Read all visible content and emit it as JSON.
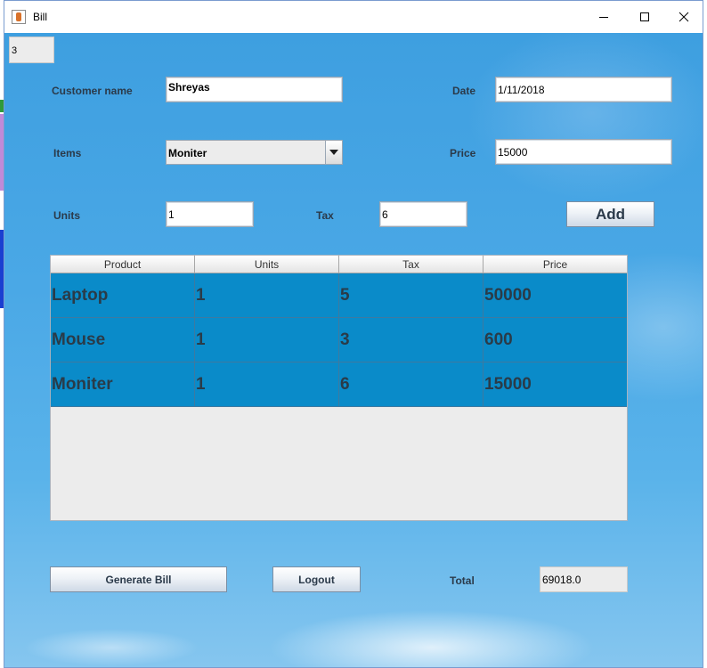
{
  "window": {
    "title": "Bill"
  },
  "form": {
    "counter": "3",
    "customer_label": "Customer name",
    "customer_value": "Shreyas",
    "date_label": "Date",
    "date_value": "1/11/2018",
    "items_label": "Items",
    "items_selected": "Moniter",
    "price_label": "Price",
    "price_value": "15000",
    "units_label": "Units",
    "units_value": "1",
    "tax_label": "Tax",
    "tax_value": "6",
    "add_label": "Add"
  },
  "table": {
    "columns": [
      "Product",
      "Units",
      "Tax",
      "Price"
    ],
    "rows": [
      [
        "Laptop",
        "1",
        "5",
        "50000"
      ],
      [
        "Mouse",
        "1",
        "3",
        "600"
      ],
      [
        "Moniter",
        "1",
        "6",
        "15000"
      ]
    ],
    "row_color": "#0a8bc9"
  },
  "footer": {
    "generate_label": "Generate Bill",
    "logout_label": "Logout",
    "total_label": "Total",
    "total_value": "69018.0"
  },
  "icons": {
    "app": "java-icon",
    "minimize": "minimize-icon",
    "maximize": "maximize-icon",
    "close": "close-icon",
    "dropdown": "chevron-down-icon"
  }
}
